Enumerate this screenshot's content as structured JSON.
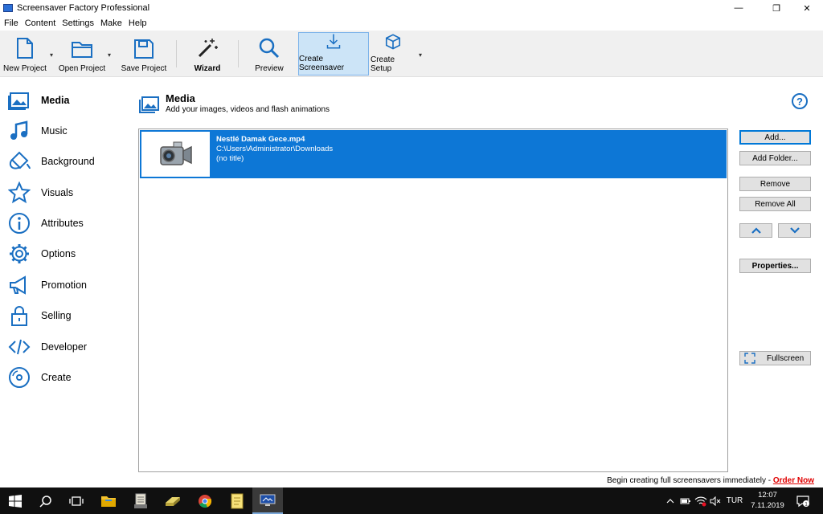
{
  "window": {
    "title": "Screensaver Factory Professional",
    "minimize": "—",
    "maximize": "❐",
    "close": "✕"
  },
  "menu": [
    "File",
    "Content",
    "Settings",
    "Make",
    "Help"
  ],
  "toolbar": {
    "new_project": "New Project",
    "open_project": "Open Project",
    "save_project": "Save Project",
    "wizard": "Wizard",
    "preview": "Preview",
    "create_screensaver": "Create Screensaver",
    "create_setup": "Create Setup"
  },
  "sidebar": {
    "items": [
      {
        "label": "Media",
        "icon": "image-icon",
        "active": true
      },
      {
        "label": "Music",
        "icon": "music-note-icon"
      },
      {
        "label": "Background",
        "icon": "paint-bucket-icon"
      },
      {
        "label": "Visuals",
        "icon": "star-icon"
      },
      {
        "label": "Attributes",
        "icon": "info-icon"
      },
      {
        "label": "Options",
        "icon": "gear-icon"
      },
      {
        "label": "Promotion",
        "icon": "megaphone-icon"
      },
      {
        "label": "Selling",
        "icon": "lock-icon"
      },
      {
        "label": "Developer",
        "icon": "code-icon"
      },
      {
        "label": "Create",
        "icon": "disc-icon"
      }
    ]
  },
  "header": {
    "title": "Media",
    "subtitle": "Add your images, videos and flash animations",
    "help": "?"
  },
  "media_list": [
    {
      "name": "Nestlé Damak Gece.mp4",
      "path": "C:\\Users\\Administrator\\Downloads",
      "title": "(no title)",
      "selected": true
    }
  ],
  "buttons": {
    "add": "Add...",
    "add_folder": "Add Folder...",
    "remove": "Remove",
    "remove_all": "Remove All",
    "up": "︿",
    "down": "﹀",
    "properties": "Properties...",
    "fullscreen": "Fullscreen"
  },
  "promo": {
    "text": "Begin creating full screensavers immediately - ",
    "link": "Order Now"
  },
  "taskbar": {
    "lang": "TUR",
    "time": "12:07",
    "date": "7.11.2019",
    "notifications": "1"
  },
  "colors": {
    "accent": "#0d77d6",
    "icon_blue": "#1a6fc2",
    "promo_link": "#e00000"
  }
}
